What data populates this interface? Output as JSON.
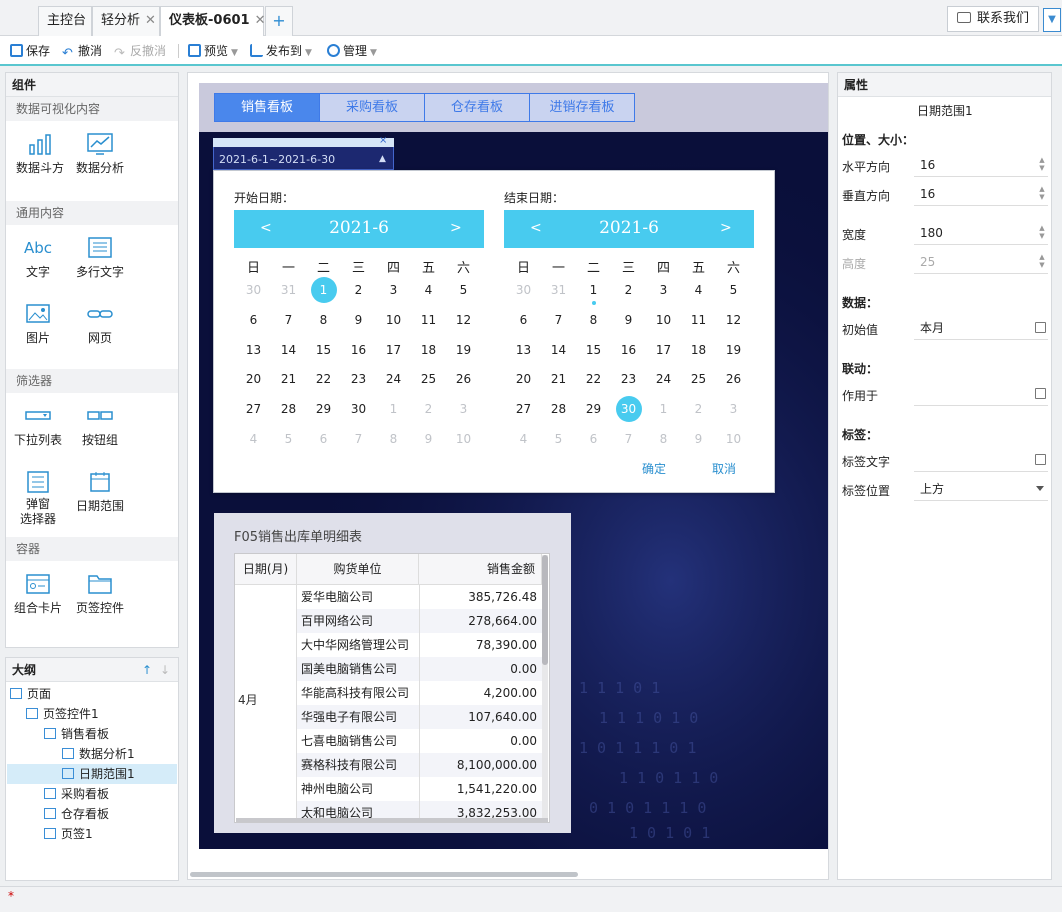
{
  "tabs": [
    {
      "label": "主控台",
      "closable": false,
      "active": false
    },
    {
      "label": "轻分析",
      "closable": true,
      "active": false
    },
    {
      "label": "仪表板-0601",
      "closable": true,
      "active": true
    }
  ],
  "tab_add": "+",
  "contact": "联系我们",
  "toolbar": {
    "save": "保存",
    "undo": "撤消",
    "redo": "反撤消",
    "preview": "预览",
    "publish": "发布到",
    "manage": "管理"
  },
  "left": {
    "title": "组件",
    "sections": {
      "viz": "数据可视化内容",
      "general": "通用内容",
      "filter": "筛选器",
      "container": "容器"
    },
    "items": {
      "data_bucket": "数据斗方",
      "data_analysis": "数据分析",
      "text": "文字",
      "multiline": "多行文字",
      "image": "图片",
      "webpage": "网页",
      "dropdown": "下拉列表",
      "button_group": "按钮组",
      "popup_line1": "弹窗",
      "popup_line2": "选择器",
      "date_range": "日期范围",
      "combo_card": "组合卡片",
      "tab_control": "页签控件"
    },
    "text_icon_glyph": "Abc"
  },
  "outline": {
    "title": "大纲",
    "nodes": [
      "页面",
      "页签控件1",
      "销售看板",
      "数据分析1",
      "日期范围1",
      "采购看板",
      "仓存看板",
      "页签1"
    ]
  },
  "dashboard": {
    "tabs": [
      "销售看板",
      "采购看板",
      "仓存看板",
      "进销存看板"
    ],
    "date_value": "2021-6-1~2021-6-30",
    "close_glyph": "×"
  },
  "calendar": {
    "start_label": "开始日期：",
    "end_label": "结束日期：",
    "left_month": "2021-6",
    "right_month": "2021-6",
    "prev": "<",
    "next": ">",
    "weekdays": [
      "日",
      "一",
      "二",
      "三",
      "四",
      "五",
      "六"
    ],
    "left_selected": 1,
    "right_selected": 30,
    "right_today": 1,
    "confirm": "确定",
    "cancel": "取消"
  },
  "table": {
    "title": "F05销售出库单明细表",
    "headers": [
      "日期(月)",
      "购货单位",
      "销售金额"
    ],
    "month": "4月",
    "rows": [
      [
        "爱华电脑公司",
        "385,726.48"
      ],
      [
        "百甲网络公司",
        "278,664.00"
      ],
      [
        "大中华网络管理公司",
        "78,390.00"
      ],
      [
        "国美电脑销售公司",
        "0.00"
      ],
      [
        "华能高科技有限公司",
        "4,200.00"
      ],
      [
        "华强电子有限公司",
        "107,640.00"
      ],
      [
        "七喜电脑销售公司",
        "0.00"
      ],
      [
        "赛格科技有限公司",
        "8,100,000.00"
      ],
      [
        "神州电脑公司",
        "1,541,220.00"
      ],
      [
        "太和电脑公司",
        "3,832,253.00"
      ]
    ]
  },
  "props": {
    "title": "属性",
    "component": "日期范围1",
    "pos_size": "位置、大小：",
    "h_label": "水平方向",
    "h_value": "16",
    "v_label": "垂直方向",
    "v_value": "16",
    "w_label": "宽度",
    "w_value": "180",
    "ht_label": "高度",
    "ht_value": "25",
    "data_section": "数据：",
    "init_label": "初始值",
    "init_value": "本月",
    "link_section": "联动：",
    "apply_label": "作用于",
    "apply_value": "",
    "tag_section": "标签：",
    "tag_text_label": "标签文字",
    "tag_text_value": "",
    "tag_pos_label": "标签位置",
    "tag_pos_value": "上方"
  },
  "status": "*",
  "colors": {
    "accent": "#48cbef",
    "tab_blue": "#4a87ec",
    "teal_line": "#59c6cf",
    "dash_bg": "#0a0f3a"
  }
}
